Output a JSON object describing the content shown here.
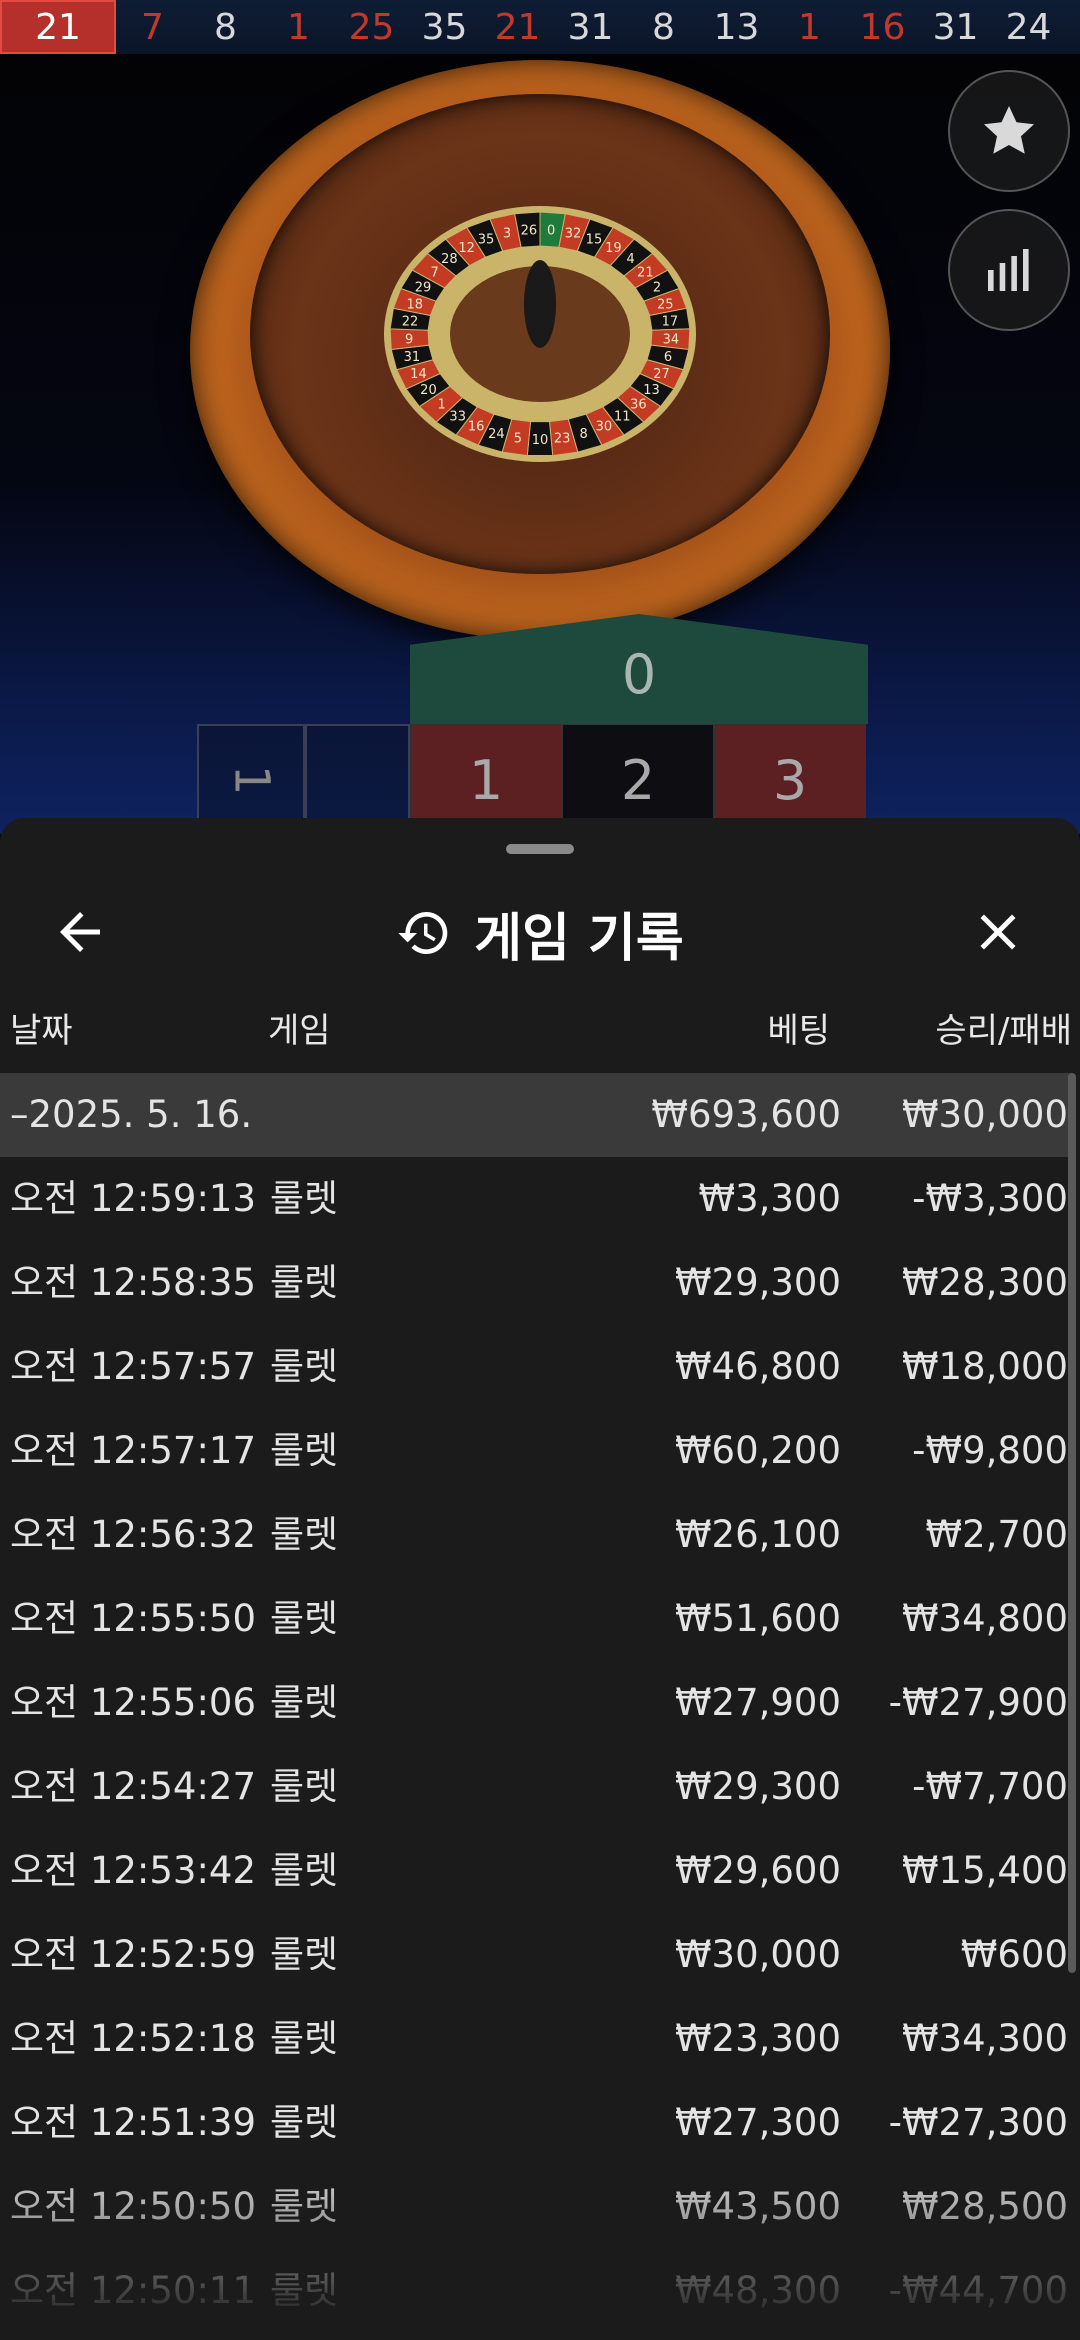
{
  "results_strip": [
    {
      "n": "21",
      "color": "red"
    },
    {
      "n": "7",
      "color": "red"
    },
    {
      "n": "8",
      "color": "black"
    },
    {
      "n": "1",
      "color": "red"
    },
    {
      "n": "25",
      "color": "red"
    },
    {
      "n": "35",
      "color": "black"
    },
    {
      "n": "21",
      "color": "red"
    },
    {
      "n": "31",
      "color": "black"
    },
    {
      "n": "8",
      "color": "black"
    },
    {
      "n": "13",
      "color": "black"
    },
    {
      "n": "1",
      "color": "red"
    },
    {
      "n": "16",
      "color": "red"
    },
    {
      "n": "31",
      "color": "black"
    },
    {
      "n": "24",
      "color": "black"
    }
  ],
  "wheel_numbers": [
    "0",
    "32",
    "15",
    "19",
    "4",
    "21",
    "2",
    "25",
    "17",
    "34",
    "6",
    "27",
    "13",
    "36",
    "11",
    "30",
    "8",
    "23",
    "10",
    "5",
    "24",
    "16",
    "33",
    "1",
    "20",
    "14",
    "31",
    "9",
    "22",
    "18",
    "29",
    "7",
    "28",
    "12",
    "35",
    "3",
    "26"
  ],
  "side_buttons": {
    "favorite": "star-icon",
    "statistics": "bar-chart-icon"
  },
  "table": {
    "zero": "0",
    "numbers": [
      {
        "n": "1",
        "color": "red"
      },
      {
        "n": "2",
        "color": "black"
      },
      {
        "n": "3",
        "color": "red"
      }
    ],
    "side_left": "1"
  },
  "sheet": {
    "title": "게임 기록",
    "columns": {
      "date": "날짜",
      "game": "게임",
      "bet": "베팅",
      "result": "승리/패배"
    },
    "summary": {
      "date": "–2025. 5. 16.",
      "bet": "₩693,600",
      "result": "₩30,000"
    },
    "rows": [
      {
        "time": "오전 12:59:13",
        "game": "룰렛",
        "bet": "₩3,300",
        "result": "-₩3,300"
      },
      {
        "time": "오전 12:58:35",
        "game": "룰렛",
        "bet": "₩29,300",
        "result": "₩28,300"
      },
      {
        "time": "오전 12:57:57",
        "game": "룰렛",
        "bet": "₩46,800",
        "result": "₩18,000"
      },
      {
        "time": "오전 12:57:17",
        "game": "룰렛",
        "bet": "₩60,200",
        "result": "-₩9,800"
      },
      {
        "time": "오전 12:56:32",
        "game": "룰렛",
        "bet": "₩26,100",
        "result": "₩2,700"
      },
      {
        "time": "오전 12:55:50",
        "game": "룰렛",
        "bet": "₩51,600",
        "result": "₩34,800"
      },
      {
        "time": "오전 12:55:06",
        "game": "룰렛",
        "bet": "₩27,900",
        "result": "-₩27,900"
      },
      {
        "time": "오전 12:54:27",
        "game": "룰렛",
        "bet": "₩29,300",
        "result": "-₩7,700"
      },
      {
        "time": "오전 12:53:42",
        "game": "룰렛",
        "bet": "₩29,600",
        "result": "₩15,400"
      },
      {
        "time": "오전 12:52:59",
        "game": "룰렛",
        "bet": "₩30,000",
        "result": "₩600"
      },
      {
        "time": "오전 12:52:18",
        "game": "룰렛",
        "bet": "₩23,300",
        "result": "₩34,300"
      },
      {
        "time": "오전 12:51:39",
        "game": "룰렛",
        "bet": "₩27,300",
        "result": "-₩27,300"
      },
      {
        "time": "오전 12:50:50",
        "game": "룰렛",
        "bet": "₩43,500",
        "result": "₩28,500"
      },
      {
        "time": "오전 12:50:11",
        "game": "룰렛",
        "bet": "₩48,300",
        "result": "-₩44,700"
      }
    ]
  }
}
